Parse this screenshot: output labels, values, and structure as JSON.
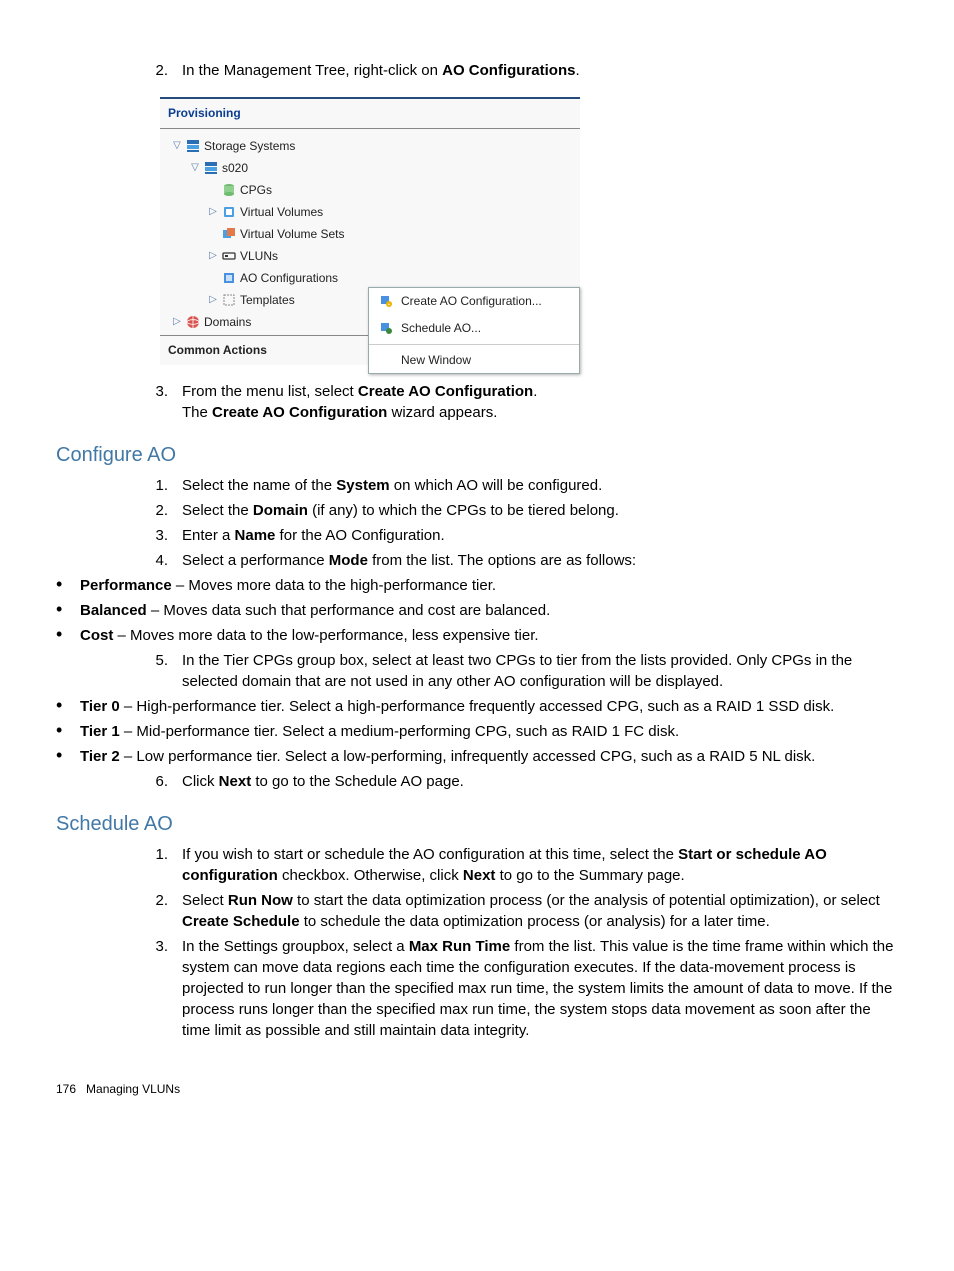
{
  "step2": {
    "num": "2.",
    "pre": "In the Management Tree, right-click on ",
    "bold": "AO Configurations",
    "post": "."
  },
  "screenshot": {
    "title": "Provisioning",
    "tree": {
      "storage_systems": "Storage Systems",
      "s020": "s020",
      "cpgs": "CPGs",
      "vv": "Virtual Volumes",
      "vvs": "Virtual Volume Sets",
      "vluns": "VLUNs",
      "ao": "AO Configurations",
      "templates": "Templates",
      "domains": "Domains"
    },
    "common_actions": "Common Actions",
    "menu": {
      "create": "Create AO Configuration...",
      "schedule": "Schedule AO...",
      "new_window": "New Window"
    }
  },
  "step3": {
    "num": "3.",
    "line1_pre": "From the menu list, select ",
    "line1_bold": "Create AO Configuration",
    "line1_post": ".",
    "line2_pre": "The ",
    "line2_bold": "Create AO Configuration",
    "line2_post": " wizard appears."
  },
  "configure_ao": {
    "heading": "Configure AO",
    "items": [
      {
        "num": "1.",
        "pre": "Select the name of the ",
        "bold": "System",
        "post": " on which AO will be configured."
      },
      {
        "num": "2.",
        "pre": "Select the ",
        "bold": "Domain",
        "post": " (if any) to which the CPGs to be tiered belong."
      },
      {
        "num": "3.",
        "pre": "Enter a ",
        "bold": "Name",
        "post": " for the AO Configuration."
      }
    ],
    "item4": {
      "num": "4.",
      "pre": "Select a performance ",
      "bold": "Mode",
      "post": " from the list. The options are as follows:"
    },
    "modes": [
      {
        "bold": "Performance",
        "post": " – Moves more data to the high-performance tier."
      },
      {
        "bold": "Balanced",
        "post": " – Moves data such that performance and cost are balanced."
      },
      {
        "bold": "Cost",
        "post": " – Moves more data to the low-performance, less expensive tier."
      }
    ],
    "item5": {
      "num": "5.",
      "text": "In the Tier CPGs group box, select at least two CPGs to tier from the lists provided. Only CPGs in the selected domain that are not used in any other AO configuration will be displayed."
    },
    "tiers": [
      {
        "bold": "Tier 0",
        "post": " – High-performance tier. Select a high-performance frequently accessed CPG, such as a RAID 1 SSD disk."
      },
      {
        "bold": "Tier 1",
        "post": " – Mid-performance tier. Select a medium-performing CPG, such as RAID 1 FC disk."
      },
      {
        "bold": "Tier 2",
        "post": " – Low performance tier. Select a low-performing, infrequently accessed CPG, such as a RAID 5 NL disk."
      }
    ],
    "item6": {
      "num": "6.",
      "pre": "Click ",
      "bold": "Next",
      "post": " to go to the Schedule AO page."
    }
  },
  "schedule_ao": {
    "heading": "Schedule AO",
    "item1": {
      "num": "1.",
      "pre": "If you wish to start or schedule the AO configuration at this time, select the ",
      "bold1": "Start or schedule AO configuration",
      "mid": " checkbox. Otherwise, click ",
      "bold2": "Next",
      "post": " to go to the Summary page."
    },
    "item2": {
      "num": "2.",
      "pre": "Select ",
      "bold1": "Run Now",
      "mid": " to start the data optimization process (or the analysis of potential optimization), or select ",
      "bold2": "Create Schedule",
      "post": " to schedule the data optimization process (or analysis) for a later time."
    },
    "item3": {
      "num": "3.",
      "pre": "In the Settings groupbox, select a ",
      "bold": "Max Run Time",
      "post": " from the list. This value is the time frame within which the system can move data regions each time the configuration executes. If the data-movement process is projected to run longer than the specified max run time, the system limits the amount of data to move. If the process runs longer than the specified max run time, the system stops data movement as soon after the time limit as possible and still maintain data integrity."
    }
  },
  "footer": {
    "page": "176",
    "title": "Managing VLUNs"
  }
}
